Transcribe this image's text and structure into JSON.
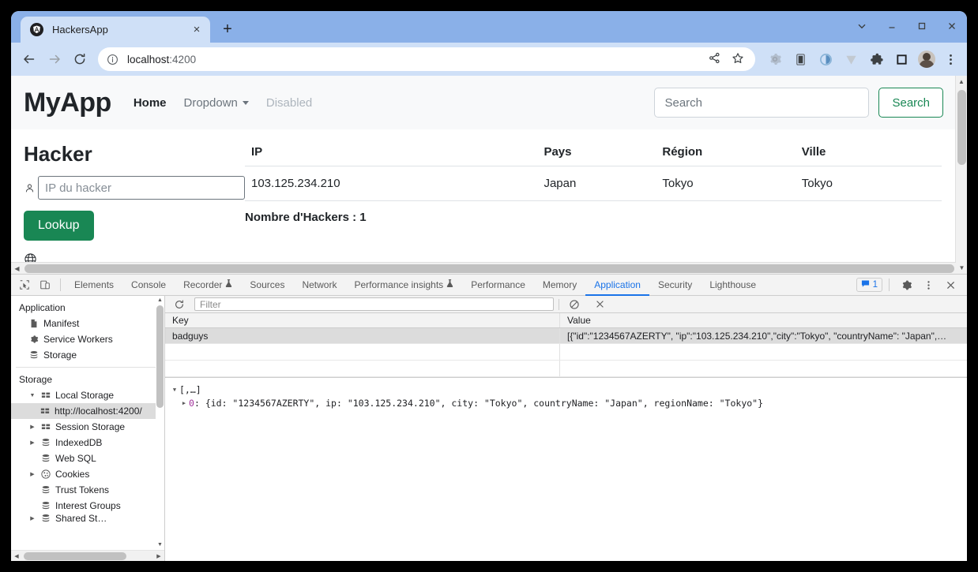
{
  "browser": {
    "tab": {
      "title": "HackersApp",
      "favicon": "angular-icon",
      "close": "×"
    },
    "new_tab": "+",
    "window_controls": {
      "tab_search": "tab-search-icon",
      "minimize": "—",
      "maximize": "□",
      "close": "✕"
    },
    "nav": {
      "back": "←",
      "forward": "→",
      "reload": "⟳"
    },
    "omnibox": {
      "info_icon": "info-icon",
      "url_main": "localhost",
      "url_port": ":4200",
      "share_icon": "share-icon",
      "bookmark_icon": "star-icon"
    },
    "extensions": [
      {
        "name": "gear-extension-icon"
      },
      {
        "name": "panel-extension-icon"
      },
      {
        "name": "circle-extension-icon"
      },
      {
        "name": "v-extension-icon"
      },
      {
        "name": "puzzle-extensions-icon"
      },
      {
        "name": "square-extension-icon"
      }
    ],
    "profile_avatar": "avatar",
    "menu_icon": "three-dot-menu-icon"
  },
  "page": {
    "navbar": {
      "brand": "MyApp",
      "links": [
        {
          "label": "Home",
          "state": "active"
        },
        {
          "label": "Dropdown",
          "state": "dropdown"
        },
        {
          "label": "Disabled",
          "state": "disabled"
        }
      ],
      "search_placeholder": "Search",
      "search_value": "",
      "search_button": "Search"
    },
    "form": {
      "heading": "Hacker",
      "ip_placeholder": "IP du hacker",
      "ip_value": "",
      "person_icon": "person-icon",
      "lookup_button": "Lookup",
      "globe_icon": "globe-icon"
    },
    "table": {
      "columns": [
        "IP",
        "Pays",
        "Région",
        "Ville"
      ],
      "rows": [
        [
          "103.125.234.210",
          "Japan",
          "Tokyo",
          "Tokyo"
        ]
      ],
      "count_label": "Nombre d'Hackers : 1"
    },
    "accent_green": "#198754"
  },
  "devtools": {
    "left_icons": [
      "inspect-element-icon",
      "device-toolbar-icon"
    ],
    "tabs": [
      {
        "label": "Elements",
        "flask": false,
        "active": false
      },
      {
        "label": "Console",
        "flask": false,
        "active": false
      },
      {
        "label": "Recorder",
        "flask": true,
        "active": false
      },
      {
        "label": "Sources",
        "flask": false,
        "active": false
      },
      {
        "label": "Network",
        "flask": false,
        "active": false
      },
      {
        "label": "Performance insights",
        "flask": true,
        "active": false
      },
      {
        "label": "Performance",
        "flask": false,
        "active": false
      },
      {
        "label": "Memory",
        "flask": false,
        "active": false
      },
      {
        "label": "Application",
        "flask": false,
        "active": true
      },
      {
        "label": "Security",
        "flask": false,
        "active": false
      },
      {
        "label": "Lighthouse",
        "flask": false,
        "active": false
      }
    ],
    "issues_count": "1",
    "issues_icon": "message-icon",
    "settings_icon": "gear-icon",
    "more_icon": "three-dot-menu-icon",
    "close_icon": "close-icon",
    "sidebar": {
      "groups": [
        {
          "title": "Application",
          "items": [
            {
              "label": "Manifest",
              "icon": "document-icon",
              "twisty": "",
              "level": 1,
              "selected": false
            },
            {
              "label": "Service Workers",
              "icon": "gear-icon",
              "twisty": "",
              "level": 1,
              "selected": false
            },
            {
              "label": "Storage",
              "icon": "database-icon",
              "twisty": "",
              "level": 1,
              "selected": false
            }
          ]
        },
        {
          "title": "Storage",
          "items": [
            {
              "label": "Local Storage",
              "icon": "table-icon",
              "twisty": "▼",
              "level": 1,
              "selected": false
            },
            {
              "label": "http://localhost:4200/",
              "icon": "table-icon",
              "twisty": "",
              "level": 2,
              "selected": true
            },
            {
              "label": "Session Storage",
              "icon": "table-icon",
              "twisty": "▶",
              "level": 1,
              "selected": false
            },
            {
              "label": "IndexedDB",
              "icon": "database-icon",
              "twisty": "▶",
              "level": 1,
              "selected": false
            },
            {
              "label": "Web SQL",
              "icon": "database-icon",
              "twisty": "",
              "level": 1,
              "selected": false
            },
            {
              "label": "Cookies",
              "icon": "cookie-icon",
              "twisty": "▶",
              "level": 1,
              "selected": false
            },
            {
              "label": "Trust Tokens",
              "icon": "database-icon",
              "twisty": "",
              "level": 1,
              "selected": false
            },
            {
              "label": "Interest Groups",
              "icon": "database-icon",
              "twisty": "",
              "level": 1,
              "selected": false
            },
            {
              "label": "Shared St…",
              "icon": "database-icon",
              "twisty": "▶",
              "level": 1,
              "selected": false
            }
          ]
        }
      ]
    },
    "storage_toolbar": {
      "refresh_icon": "refresh-icon",
      "filter_placeholder": "Filter",
      "filter_value": "",
      "clear_all_icon": "clear-all-icon",
      "delete_icon": "delete-selected-icon"
    },
    "grid": {
      "columns": [
        "Key",
        "Value"
      ],
      "rows": [
        {
          "key": "badguys",
          "value": "[{\"id\":\"1234567AZERTY\", \"ip\":\"103.125.234.210\",\"city\":\"Tokyo\", \"countryName\": \"Japan\",…",
          "selected": true
        }
      ],
      "empty_rows": 2
    },
    "preview": {
      "root_arrow": "▼",
      "root_label": "[,…]",
      "child_arrow": "▶",
      "child_index": "0",
      "child_sep": ":",
      "child_value": "{id: \"1234567AZERTY\", ip: \"103.125.234.210\", city: \"Tokyo\", countryName: \"Japan\", regionName: \"Tokyo\"}"
    }
  }
}
